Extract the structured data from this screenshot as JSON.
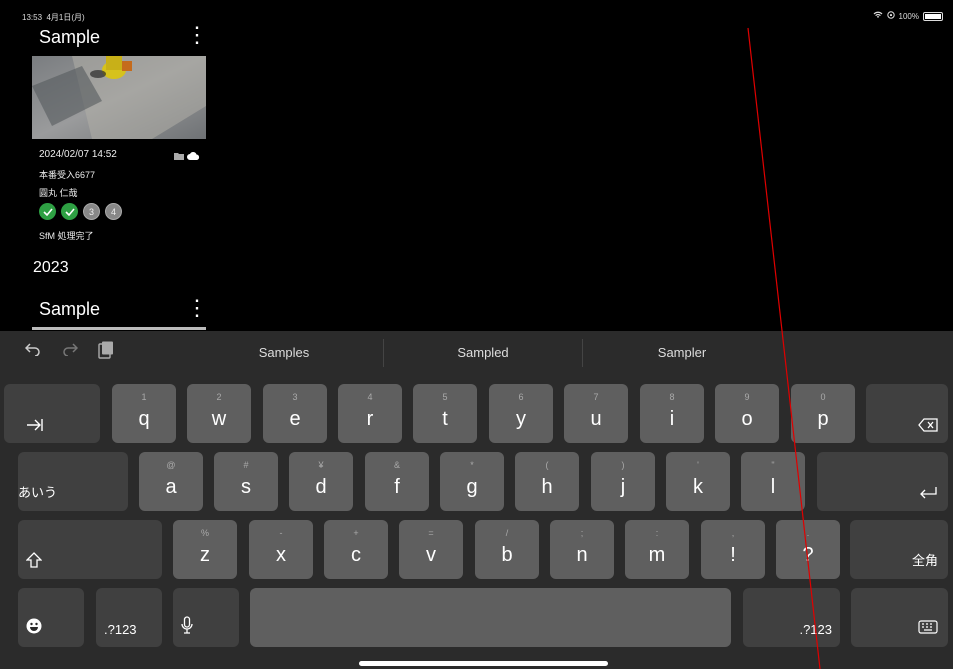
{
  "status_bar": {
    "time": "13:53",
    "date": "4月1日(月)",
    "battery": "100%"
  },
  "cards": [
    {
      "title": "Sample",
      "date": "2024/02/07  14:52",
      "line2": "本番受入6677",
      "line3": "圓丸 仁哉",
      "steps": [
        "",
        "",
        "3",
        "4"
      ],
      "status": "SfM 処理完了"
    },
    {
      "title": "Sample"
    }
  ],
  "year_header": "2023",
  "suggestions": [
    "Samples",
    "Sampled",
    "Sampler"
  ],
  "keyboard": {
    "row1": [
      {
        "k": "q",
        "h": "1"
      },
      {
        "k": "w",
        "h": "2"
      },
      {
        "k": "e",
        "h": "3"
      },
      {
        "k": "r",
        "h": "4"
      },
      {
        "k": "t",
        "h": "5"
      },
      {
        "k": "y",
        "h": "6"
      },
      {
        "k": "u",
        "h": "7"
      },
      {
        "k": "i",
        "h": "8"
      },
      {
        "k": "o",
        "h": "9"
      },
      {
        "k": "p",
        "h": "0"
      }
    ],
    "row2": [
      {
        "k": "a",
        "h": "@"
      },
      {
        "k": "s",
        "h": "#"
      },
      {
        "k": "d",
        "h": "¥"
      },
      {
        "k": "f",
        "h": "&"
      },
      {
        "k": "g",
        "h": "*"
      },
      {
        "k": "h",
        "h": "("
      },
      {
        "k": "j",
        "h": ")"
      },
      {
        "k": "k",
        "h": "'"
      },
      {
        "k": "l",
        "h": "\""
      }
    ],
    "row3": [
      {
        "k": "z",
        "h": "%"
      },
      {
        "k": "x",
        "h": "-"
      },
      {
        "k": "c",
        "h": "+"
      },
      {
        "k": "v",
        "h": "="
      },
      {
        "k": "b",
        "h": "/"
      },
      {
        "k": "n",
        "h": ";"
      },
      {
        "k": "m",
        "h": ":"
      },
      {
        "k": "!",
        "h": ","
      },
      {
        "k": "?",
        "h": "."
      }
    ],
    "kana_label": "あいう",
    "zenkaku_label": "全角",
    "numbers_left": ".?123",
    "numbers_right": ".?123",
    "tab_icon": "tab-icon",
    "delete_icon": "delete-icon",
    "return_icon": "return-icon",
    "shift_icon": "shift-icon",
    "emoji_icon": "emoji-icon",
    "mic_icon": "microphone-icon",
    "hide_keyboard_icon": "keyboard-hide-icon"
  },
  "colors": {
    "step_done": "#2ea043",
    "annotation_line": "#e00000"
  }
}
